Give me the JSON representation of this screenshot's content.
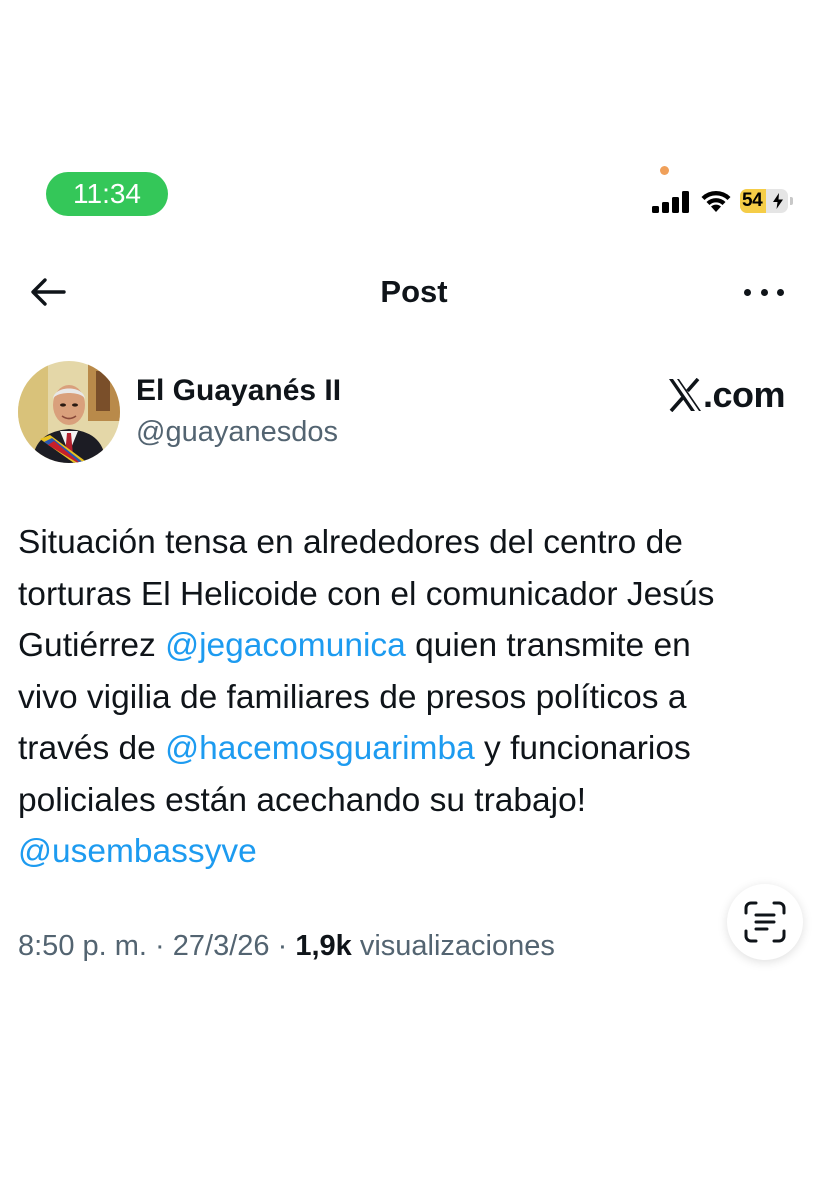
{
  "status_bar": {
    "time": "11:34",
    "battery_level": "54",
    "battery_fraction": 0.54,
    "icons": [
      "privacy-dot",
      "cellular-signal-icon",
      "wifi-icon",
      "battery-charging-icon"
    ]
  },
  "header": {
    "title": "Post",
    "back_icon": "arrow-left-icon",
    "more_icon": "more-horizontal-icon"
  },
  "author": {
    "name": "El Guayanés II",
    "handle": "@guayanesdos",
    "brand_text": ".com"
  },
  "post": {
    "lines": [
      [
        {
          "text": "Situación tensa en alrededores del centro de",
          "mention": false
        }
      ],
      [
        {
          "text": "torturas El Helicoide con el comunicador Jesús",
          "mention": false
        }
      ],
      [
        {
          "text": "Gutiérrez ",
          "mention": false
        },
        {
          "text": "@jegacomunica",
          "mention": true
        },
        {
          "text": " quien transmite en",
          "mention": false
        }
      ],
      [
        {
          "text": "vivo vigilia de familiares de presos políticos a",
          "mention": false
        }
      ],
      [
        {
          "text": "través de ",
          "mention": false
        },
        {
          "text": "@hacemosguarimba",
          "mention": true
        },
        {
          "text": " y funcionarios",
          "mention": false
        }
      ],
      [
        {
          "text": "policiales están acechando su trabajo!",
          "mention": false
        }
      ],
      [
        {
          "text": "@usembassyve",
          "mention": true
        }
      ]
    ],
    "time": "8:50 p. m.",
    "separator": "·",
    "date": "27/3/26",
    "views_count": "1,9k",
    "views_label": "visualizaciones"
  },
  "colors": {
    "mention": "#1d9bf0",
    "secondary_text": "#536471",
    "status_green": "#34c759",
    "battery_yellow": "#f5cd47"
  }
}
